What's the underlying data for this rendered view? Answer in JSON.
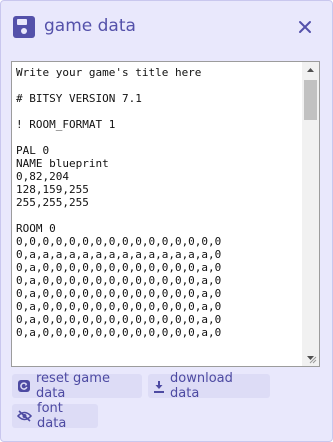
{
  "panel": {
    "title": "game data",
    "icon": "save-icon",
    "close_icon": "close-icon"
  },
  "editor": {
    "content": "Write your game's title here\n\n# BITSY VERSION 7.1\n\n! ROOM_FORMAT 1\n\nPAL 0\nNAME blueprint\n0,82,204\n128,159,255\n255,255,255\n\nROOM 0\n0,0,0,0,0,0,0,0,0,0,0,0,0,0,0,0\n0,a,a,a,a,a,a,a,a,a,a,a,a,a,a,0\n0,a,0,0,0,0,0,0,0,0,0,0,0,0,a,0\n0,a,0,0,0,0,0,0,0,0,0,0,0,0,a,0\n0,a,0,0,0,0,0,0,0,0,0,0,0,0,a,0\n0,a,0,0,0,0,0,0,0,0,0,0,0,0,a,0\n0,a,0,0,0,0,0,0,0,0,0,0,0,0,a,0\n0,a,0,0,0,0,0,0,0,0,0,0,0,0,a,0"
  },
  "actions": {
    "reset_label": "reset game data",
    "reset_icon": "reset-icon",
    "download_label": "download data",
    "download_icon": "download-icon",
    "font_label": "font data",
    "font_icon": "eye-off-icon"
  },
  "colors": {
    "accent": "#5451aa",
    "panel_bg": "#e9e8fc",
    "button_bg": "#dddcf6"
  }
}
